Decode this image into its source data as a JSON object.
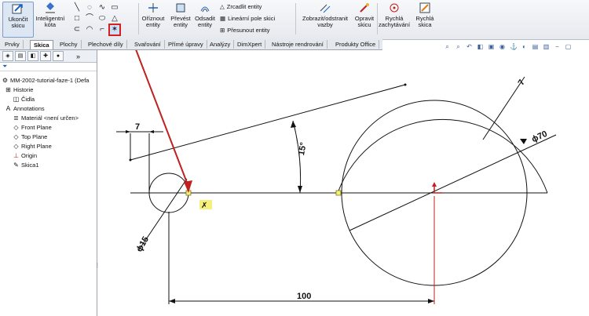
{
  "ribbon": {
    "exit_sketch": "Ukončit skicu",
    "smart_dimension": "Inteligentní kóta",
    "trim": "Oříznout entity",
    "convert": "Převést entity",
    "offset": "Odsadit entity",
    "mirror": "Zrcadlit entity",
    "linear_pattern": "Lineární pole skici",
    "move": "Přesunout entity",
    "display_relations": "Zobrazit/odstranit vazby",
    "repair": "Opravit skicu",
    "rapid_snaps": "Rychlá zachytávání",
    "rapid_sketch": "Rychlá skica",
    "selected_tool_icon": "point-icon"
  },
  "tabs": [
    "Prvky",
    "Skica",
    "Plochy",
    "Plechové díly",
    "Svařování",
    "Přímé úpravy",
    "Analýzy",
    "DimXpert",
    "Nástroje rendrování",
    "Produkty Office"
  ],
  "active_tab": "Skica",
  "tree": {
    "root": "MM-2002-tutorial-faze-1  (Defa",
    "items": [
      "Historie",
      "Čidla",
      "Annotations",
      "Materiál <není určen>",
      "Front Plane",
      "Top Plane",
      "Right Plane",
      "Origin",
      "Skica1"
    ]
  },
  "drawing": {
    "dim_7_left": "7",
    "dim_angle": "15°",
    "dim_7_right": "7",
    "dim_diam_70": "ϕ70",
    "dim_diam_15": "ϕ15",
    "dim_100": "100",
    "annotation_color": "#c0201f"
  },
  "colors": {
    "accent_red": "#c0201f",
    "highlight_yellow": "#f5f07a"
  }
}
